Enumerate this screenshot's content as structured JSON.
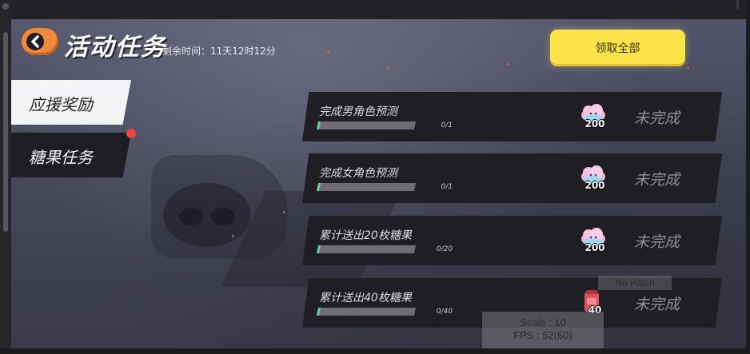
{
  "header": {
    "title": "活动任务",
    "remaining_time": "剩余时间：11天12时12分",
    "claim_all_label": "领取全部"
  },
  "tabs": [
    {
      "label": "应援奖励",
      "selected": true
    },
    {
      "label": "糖果任务",
      "selected": false,
      "has_badge": true
    }
  ],
  "tasks": [
    {
      "name": "完成男角色预测",
      "progress": "0/1",
      "progress_fraction": 0.0,
      "reward_icon": "candy-cloud-icon",
      "reward_amount": "200",
      "status": "未完成"
    },
    {
      "name": "完成女角色预测",
      "progress": "0/1",
      "progress_fraction": 0.0,
      "reward_icon": "candy-cloud-icon",
      "reward_amount": "200",
      "status": "未完成"
    },
    {
      "name": "累计送出20枚糖果",
      "progress": "0/20",
      "progress_fraction": 0.0,
      "reward_icon": "candy-cloud-icon",
      "reward_amount": "200",
      "status": "未完成"
    },
    {
      "name": "累计送出40枚糖果",
      "progress": "0/40",
      "progress_fraction": 0.0,
      "reward_icon": "red-jar-icon",
      "reward_amount": "40",
      "status": "未完成"
    }
  ],
  "debug": {
    "no_patch": "No Patch",
    "scale": "Scale : 10",
    "fps": "FPS : 52(60)"
  },
  "colors": {
    "accent_orange": "#f08a38",
    "claim_yellow": "#fde44a",
    "badge_red": "#f04545",
    "progress_green": "#5fd0a0"
  }
}
